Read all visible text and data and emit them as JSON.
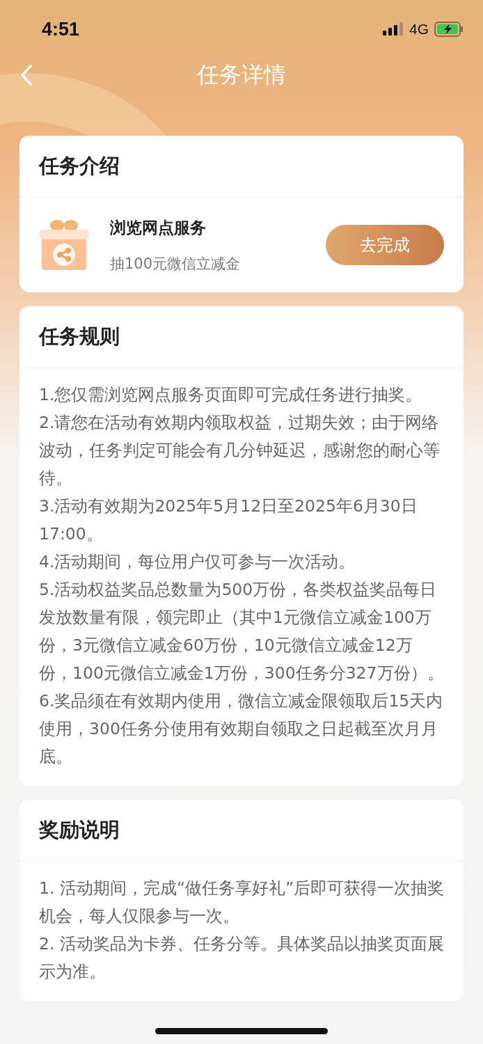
{
  "status_bar": {
    "time": "4:51",
    "network": "4G"
  },
  "nav": {
    "title": "任务详情"
  },
  "intro": {
    "title": "任务介绍",
    "task": {
      "name": "浏览网点服务",
      "reward": "抽100元微信立减金",
      "button": "去完成"
    }
  },
  "rules": {
    "title": "任务规则",
    "items": [
      "1.您仅需浏览网点服务页面即可完成任务进行抽奖。",
      "2.请您在活动有效期内领取权益，过期失效；由于网络波动，任务判定可能会有几分钟延迟，感谢您的耐心等待。",
      "3.活动有效期为2025年5月12日至2025年6月30日17:00。",
      "4.活动期间，每位用户仅可参与一次活动。",
      "5.活动权益奖品总数量为500万份，各类权益奖品每日发放数量有限，领完即止（其中1元微信立减金100万份，3元微信立减金60万份，10元微信立减金12万份，100元微信立减金1万份，300任务分327万份）。",
      "6.奖品须在有效期内使用，微信立减金限领取后15天内使用，300任务分使用有效期自领取之日起截至次月月底。"
    ]
  },
  "reward_info": {
    "title": "奖励说明",
    "items": [
      "1. 活动期间，完成“做任务享好礼”后即可获得一次抽奖机会，每人仅限参与一次。",
      "2. 活动奖品为卡券、任务分等。具体奖品以抽奖页面展示为准。"
    ]
  }
}
